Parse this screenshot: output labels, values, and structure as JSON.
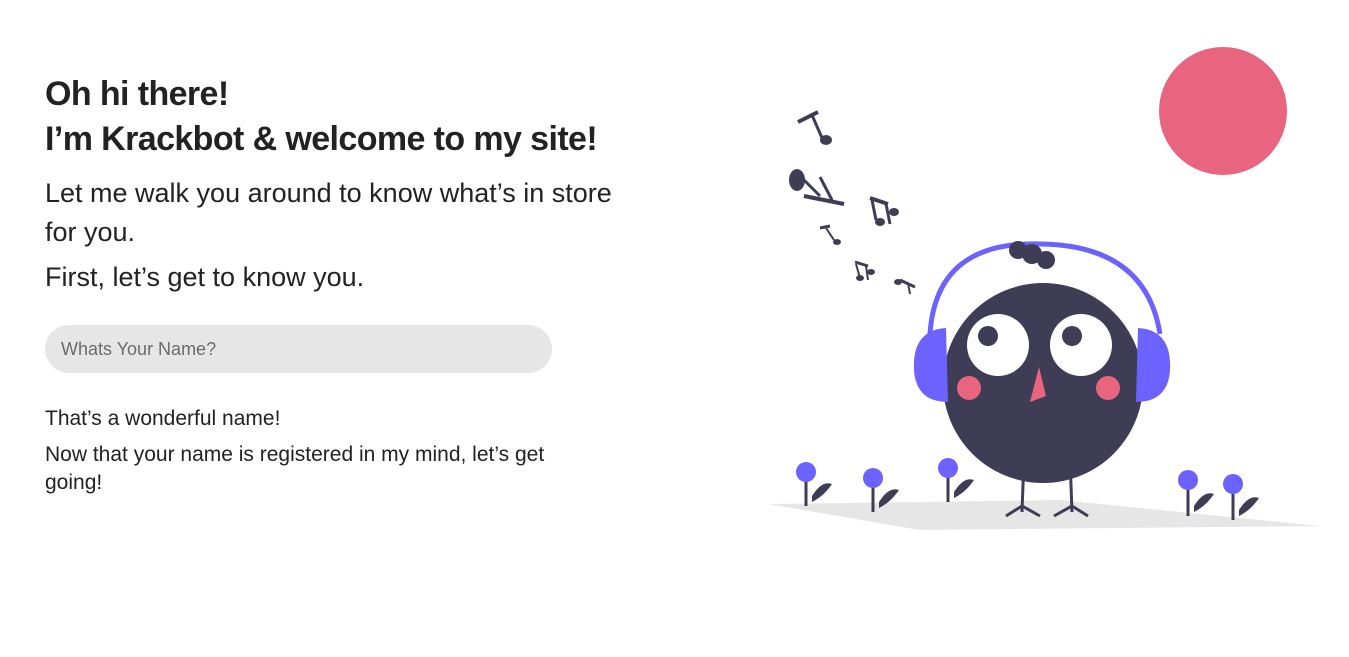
{
  "heading": {
    "line1": "Oh hi there!",
    "line2": "I’m Krackbot & welcome to my site!"
  },
  "intro": {
    "walk": "Let me walk you around to know what’s in store for you.",
    "know": "First, let’s get to know you."
  },
  "name_field": {
    "placeholder": "Whats Your Name?",
    "value": ""
  },
  "response": {
    "line1": "That’s a wonderful name!",
    "line2": "Now that your name is registered in my mind, let’s get going!"
  },
  "illustration": {
    "subject": "bird-with-headphones",
    "colors": {
      "sun": "#e9657f",
      "body": "#3f3d56",
      "headphones": "#6c63ff",
      "cheeks": "#e9657f",
      "beak": "#e9657f",
      "flowers": "#6c63ff",
      "ground": "#e6e6e6"
    }
  }
}
